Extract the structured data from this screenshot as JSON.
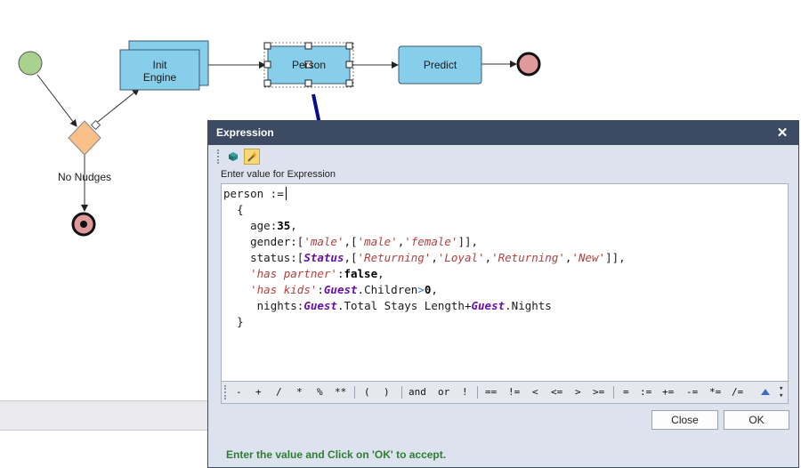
{
  "diagram": {
    "nodes": {
      "init_engine": "Init\nEngine",
      "person": "Person",
      "predict": "Predict",
      "no_nudges": "No Nudges"
    }
  },
  "dialog": {
    "title": "Expression",
    "close_icon": "close-icon",
    "toolbar": [
      "cube-icon",
      "wand-icon"
    ],
    "prompt_label": "Enter value for Expression",
    "code": {
      "assign_lhs": "person :=",
      "open_brace": "{",
      "age_key": "age",
      "age_value": "35",
      "gender_key": "gender",
      "gender_value": "'male'",
      "gender_options": [
        "'male'",
        "'female'"
      ],
      "status_key": "status",
      "status_value": "Status",
      "status_options": [
        "'Returning'",
        "'Loyal'",
        "'Returning'",
        "'New'"
      ],
      "has_partner_key": "'has partner'",
      "has_partner_value": "false",
      "has_kids_key": "'has kids'",
      "has_kids_obj": "Guest",
      "has_kids_prop": ".Children",
      "has_kids_op": ">",
      "has_kids_value": "0",
      "nights_key": "nights",
      "nights_obj1": "Guest",
      "nights_prop1": ".Total Stays Length",
      "nights_op": "+",
      "nights_obj2": "Guest",
      "nights_prop2": ".Nights",
      "close_brace": "}"
    },
    "operators": [
      "-",
      "+",
      "/",
      "*",
      "%",
      "**",
      "(",
      ")",
      "and",
      "or",
      "!",
      "==",
      "!=",
      "<",
      "<=",
      ">",
      ">=",
      "=",
      ":=",
      "+=",
      "-=",
      "*=",
      "/="
    ],
    "close_label": "Close",
    "ok_label": "OK",
    "status_text": "Enter the value and Click on 'OK' to accept."
  },
  "colors": {
    "title_bar": "#3c4b63",
    "task_fill": "#87ceeb",
    "start_event": "#a9d18e",
    "end_event": "#e09a9a",
    "gateway": "#f9c089",
    "annotation_arrow": "#0a0a8c",
    "status_text": "#2e7d32"
  }
}
